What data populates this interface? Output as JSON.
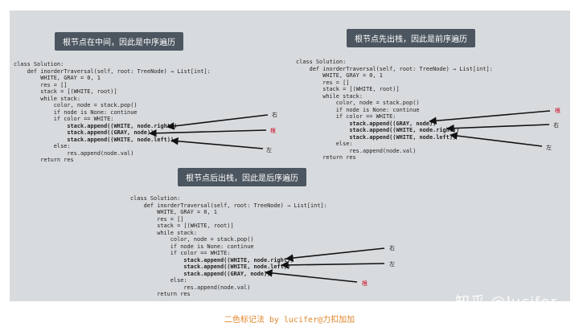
{
  "panels": [
    {
      "label": "根节点在中间，因此是中序遍历",
      "code": [
        "class Solution:",
        "    def inorderTraversal(self, root: TreeNode) → List[int]:",
        "        WHITE, GRAY = 0, 1",
        "        res = []",
        "        stack = [(WHITE, root)]",
        "        while stack:",
        "            color, node = stack.pop()",
        "            if node is None: continue",
        "            if color == WHITE:",
        "                stack.append((WHITE, node.right))",
        "                stack.append((GRAY, node))",
        "                stack.append((WHITE, node.left))",
        "            else:",
        "                res.append(node.val)",
        "        return res"
      ],
      "annotations": [
        "右",
        "根",
        "左"
      ]
    },
    {
      "label": "根节点先出栈，因此是前序遍历",
      "code": [
        "class Solution:",
        "    def inorderTraversal(self, root: TreeNode) → List[int]:",
        "        WHITE, GRAY = 0, 1",
        "        res = []",
        "        stack = [(WHITE, root)]",
        "        while stack:",
        "            color, node = stack.pop()",
        "            if node is None: continue",
        "            if color == WHITE:",
        "                stack.append((GRAY, node))",
        "                stack.append((WHITE, node.right))",
        "                stack.append((WHITE, node.left))",
        "            else:",
        "                res.append(node.val)",
        "        return res"
      ],
      "annotations": [
        "根",
        "右",
        "左"
      ]
    },
    {
      "label": "根节点后出栈，因此是后序遍历",
      "code": [
        "class Solution:",
        "    def inorderTraversal(self, root: TreeNode) → List[int]:",
        "        WHITE, GRAY = 0, 1",
        "        res = []",
        "        stack = [(WHITE, root)]",
        "        while stack:",
        "            color, node = stack.pop()",
        "            if node is None: continue",
        "            if color == WHITE:",
        "                stack.append((WHITE, node.right))",
        "                stack.append((WHITE, node.left))",
        "                stack.append((GRAY, node))",
        "            else:",
        "                res.append(node.val)",
        "        return res"
      ],
      "annotations": [
        "右",
        "左",
        "根"
      ]
    }
  ],
  "caption": "二色标记法 by lucifer@力扣加加",
  "watermark": "知乎 @lucifer",
  "colors": {
    "label_bg": "#4c5660",
    "root_annotation": "#d0021b",
    "caption": "#e0872a",
    "background": "#d8dbde"
  }
}
